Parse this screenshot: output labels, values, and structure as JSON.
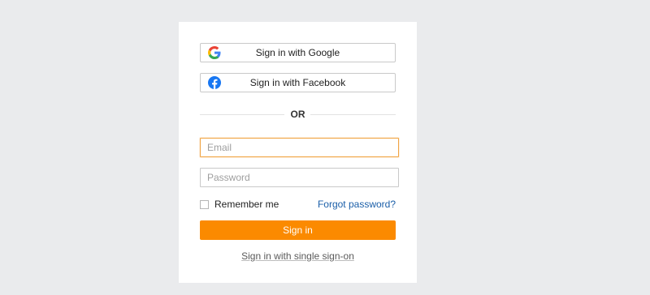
{
  "social": {
    "google": {
      "label": "Sign in with Google",
      "icon": "google-icon"
    },
    "facebook": {
      "label": "Sign in with Facebook",
      "icon": "facebook-icon"
    }
  },
  "divider": {
    "text": "OR"
  },
  "form": {
    "email": {
      "value": "",
      "placeholder": "Email"
    },
    "password": {
      "value": "",
      "placeholder": "Password"
    },
    "remember_label": "Remember me",
    "remember_checked": false,
    "forgot_label": "Forgot password?",
    "signin_label": "Sign in",
    "sso_label": "Sign in with single sign-on"
  },
  "colors": {
    "background": "#eaebed",
    "card": "#ffffff",
    "accent": "#fb8a00",
    "focus_border": "#f0a443",
    "link": "#1a5ea8",
    "facebook_blue": "#1877f2"
  }
}
